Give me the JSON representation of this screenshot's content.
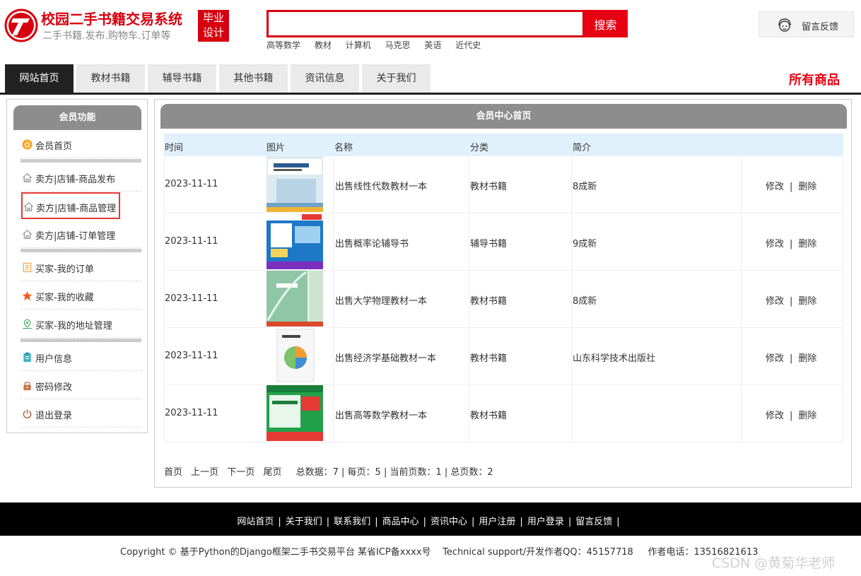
{
  "header": {
    "title": "校园二手书籍交易系统",
    "subtitle": "二手书籍.发布.购物车.订单等",
    "badge_line1": "毕业",
    "badge_line2": "设计",
    "search_placeholder": "",
    "search_button": "搜索",
    "hot_words": [
      "高等数学",
      "教材",
      "计算机",
      "马克思",
      "英语",
      "近代史"
    ],
    "feedback_label": "留言反馈"
  },
  "nav": {
    "tabs": [
      "网站首页",
      "教材书籍",
      "辅导书籍",
      "其他书籍",
      "资讯信息",
      "关于我们"
    ],
    "all_goods": "所有商品"
  },
  "sidebar": {
    "title": "会员功能",
    "items": [
      {
        "label": "会员首页",
        "icon": "home-coin-icon"
      },
      {
        "label": "卖方|店铺-商品发布",
        "icon": "house-icon"
      },
      {
        "label": "卖方|店铺-商品管理",
        "icon": "house-icon"
      },
      {
        "label": "卖方|店铺-订单管理",
        "icon": "house-icon"
      },
      {
        "label": "买家-我的订单",
        "icon": "order-list-icon"
      },
      {
        "label": "买家-我的收藏",
        "icon": "star-icon"
      },
      {
        "label": "买家-我的地址管理",
        "icon": "location-icon"
      },
      {
        "label": "用户信息",
        "icon": "clipboard-icon"
      },
      {
        "label": "密码修改",
        "icon": "lock-icon"
      },
      {
        "label": "退出登录",
        "icon": "power-icon"
      }
    ]
  },
  "main": {
    "title": "会员中心首页",
    "columns": [
      "时间",
      "图片",
      "名称",
      "分类",
      "简介",
      ""
    ],
    "rows": [
      {
        "time": "2023-11-11",
        "name": "出售线性代数教材一本",
        "category": "教材书籍",
        "intro": "8成新",
        "edit": "修改",
        "delete": "删除"
      },
      {
        "time": "2023-11-11",
        "name": "出售概率论辅导书",
        "category": "辅导书籍",
        "intro": "9成新",
        "edit": "修改",
        "delete": "删除"
      },
      {
        "time": "2023-11-11",
        "name": "出售大学物理教材一本",
        "category": "教材书籍",
        "intro": "8成新",
        "edit": "修改",
        "delete": "删除"
      },
      {
        "time": "2023-11-11",
        "name": "出售经济学基础教材一本",
        "category": "教材书籍",
        "intro": "山东科学技术出版社",
        "edit": "修改",
        "delete": "删除"
      },
      {
        "time": "2023-11-11",
        "name": "出售高等数学教材一本",
        "category": "教材书籍",
        "intro": "",
        "edit": "修改",
        "delete": "删除"
      }
    ],
    "action_separator": "|",
    "pager": {
      "first": "首页",
      "prev": "上一页",
      "next": "下一页",
      "last": "尾页",
      "stats": "总数据：7 | 每页：5 | 当前页数：1 | 总页数：2"
    }
  },
  "footer": {
    "links": [
      "网站首页",
      "关于我们",
      "联系我们",
      "商品中心",
      "资讯中心",
      "用户注册",
      "用户登录",
      "留言反馈"
    ],
    "separator": "|",
    "copyright": "Copyright © 基于Python的Django框架二手书交易平台 某省ICP备xxxx号    Technical support/开发作者QQ：45157718     作者电话：13516821613",
    "watermark": "CSDN @黄菊华老师"
  },
  "colors": {
    "brand_red": "#d7000f",
    "nav_dark": "#222222",
    "panel_gray": "#8d8d8d",
    "table_head": "#e1f1fb"
  }
}
